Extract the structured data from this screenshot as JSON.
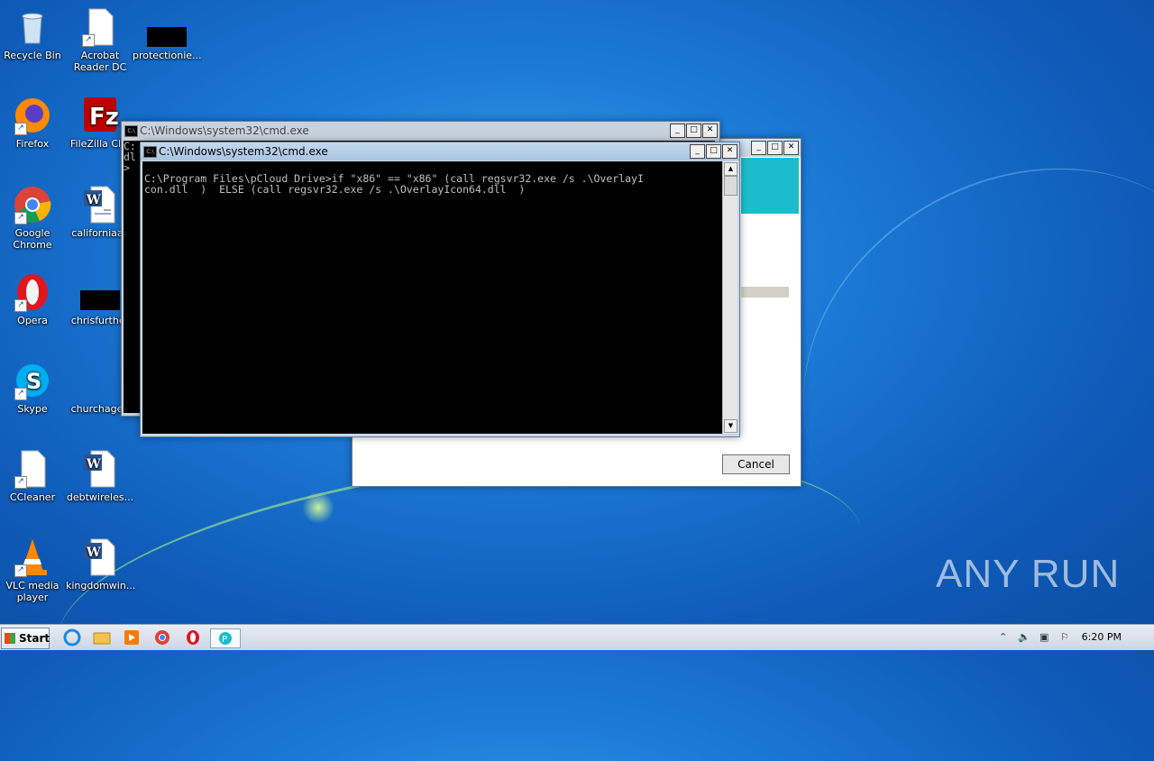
{
  "desktop_icons": [
    {
      "label": "Recycle Bin"
    },
    {
      "label": "Acrobat Reader DC"
    },
    {
      "label": "protectionie..."
    },
    {
      "label": "Firefox"
    },
    {
      "label": "FileZilla Clie"
    },
    {
      "label": "Google Chrome"
    },
    {
      "label": "californiaac"
    },
    {
      "label": "Opera"
    },
    {
      "label": "chrisfurther"
    },
    {
      "label": "Skype"
    },
    {
      "label": "churchagen"
    },
    {
      "label": "CCleaner"
    },
    {
      "label": "debtwireles..."
    },
    {
      "label": "VLC media player"
    },
    {
      "label": "kingdomwin..."
    }
  ],
  "back_cmd": {
    "title": "C:\\Windows\\system32\\cmd.exe",
    "visible_text": "C:\ndl\n>"
  },
  "front_cmd": {
    "title": "C:\\Windows\\system32\\cmd.exe",
    "line1": "C:\\Program Files\\pCloud Drive>if \"x86\" == \"x86\" (call regsvr32.exe /s .\\OverlayI",
    "line2": "con.dll  )  ELSE (call regsvr32.exe /s .\\OverlayIcon64.dll  )"
  },
  "installer": {
    "cancel_label": "Cancel",
    "accent_color": "#1dbccd"
  },
  "taskbar": {
    "start_label": "Start",
    "clock": "6:20 PM"
  },
  "watermark": "ANY RUN"
}
